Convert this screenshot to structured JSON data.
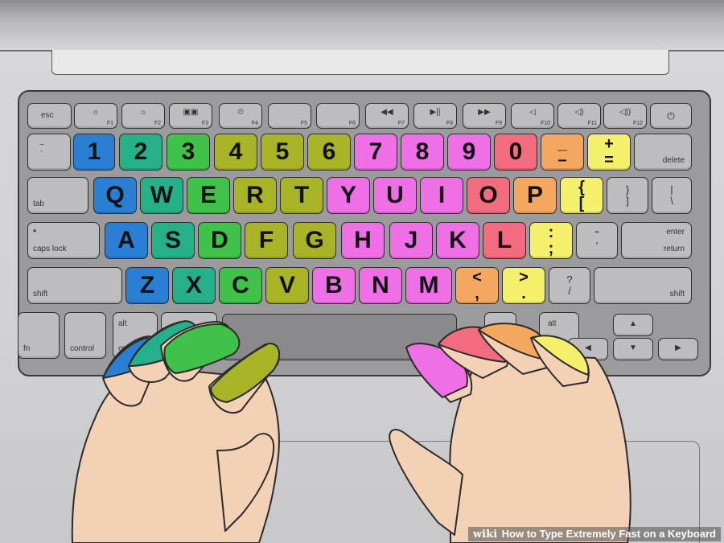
{
  "caption": {
    "brand": "wiki",
    "title": "How to Type Extremely Fast on a Keyboard"
  },
  "finger_colors": {
    "left_pinky": "#2a7fd4",
    "left_ring": "#26b08a",
    "left_middle": "#3fc14a",
    "left_index": "#a8b326",
    "right_index": "#ef6fe6",
    "right_middle": "#f26b7e",
    "right_ring": "#f4a85f",
    "right_pinky": "#f4f06c"
  },
  "keyboard": {
    "function_row": [
      {
        "id": "esc",
        "label": "esc"
      },
      {
        "id": "f1",
        "label": "F1",
        "icon": "☼"
      },
      {
        "id": "f2",
        "label": "F2",
        "icon": "☼"
      },
      {
        "id": "f3",
        "label": "F3",
        "icon": "▣▣"
      },
      {
        "id": "f4",
        "label": "F4",
        "icon": "⏲"
      },
      {
        "id": "f5",
        "label": "F5",
        "icon": ""
      },
      {
        "id": "f6",
        "label": "F6",
        "icon": ""
      },
      {
        "id": "f7",
        "label": "F7",
        "icon": "◀◀"
      },
      {
        "id": "f8",
        "label": "F8",
        "icon": "▶||"
      },
      {
        "id": "f9",
        "label": "F9",
        "icon": "▶▶"
      },
      {
        "id": "f10",
        "label": "F10",
        "icon": "◁"
      },
      {
        "id": "f11",
        "label": "F11",
        "icon": "◁)"
      },
      {
        "id": "f12",
        "label": "F12",
        "icon": "◁))"
      },
      {
        "id": "power",
        "label": "",
        "icon": "⏻"
      }
    ],
    "number_row": [
      {
        "label": "~",
        "sub": "`",
        "kind": "mod"
      },
      {
        "label": "1",
        "finger": "left_pinky"
      },
      {
        "label": "2",
        "finger": "left_ring"
      },
      {
        "label": "3",
        "finger": "left_middle"
      },
      {
        "label": "4",
        "finger": "left_index"
      },
      {
        "label": "5",
        "finger": "left_index"
      },
      {
        "label": "6",
        "finger": "left_index"
      },
      {
        "label": "7",
        "finger": "right_index"
      },
      {
        "label": "8",
        "finger": "right_index"
      },
      {
        "label": "9",
        "finger": "right_index"
      },
      {
        "label": "0",
        "finger": "right_middle"
      },
      {
        "label": "_",
        "sub": "–",
        "finger": "right_ring"
      },
      {
        "label": "+",
        "sub": "=",
        "finger": "right_pinky"
      },
      {
        "label": "delete",
        "kind": "mod"
      }
    ],
    "top_row": [
      {
        "label": "tab",
        "kind": "mod"
      },
      {
        "label": "Q",
        "finger": "left_pinky"
      },
      {
        "label": "W",
        "finger": "left_ring"
      },
      {
        "label": "E",
        "finger": "left_middle"
      },
      {
        "label": "R",
        "finger": "left_index"
      },
      {
        "label": "T",
        "finger": "left_index"
      },
      {
        "label": "Y",
        "finger": "right_index"
      },
      {
        "label": "U",
        "finger": "right_index"
      },
      {
        "label": "I",
        "finger": "right_index"
      },
      {
        "label": "O",
        "finger": "right_middle"
      },
      {
        "label": "P",
        "finger": "right_ring"
      },
      {
        "label": "{",
        "sub": "[",
        "finger": "right_pinky"
      },
      {
        "label": "}",
        "sub": "]",
        "kind": "mod"
      },
      {
        "label": "|",
        "sub": "\\",
        "kind": "mod"
      }
    ],
    "home_row": [
      {
        "label": "caps lock",
        "kind": "mod"
      },
      {
        "label": "A",
        "finger": "left_pinky"
      },
      {
        "label": "S",
        "finger": "left_ring"
      },
      {
        "label": "D",
        "finger": "left_middle"
      },
      {
        "label": "F",
        "finger": "left_index"
      },
      {
        "label": "G",
        "finger": "left_index"
      },
      {
        "label": "H",
        "finger": "right_index"
      },
      {
        "label": "J",
        "finger": "right_index"
      },
      {
        "label": "K",
        "finger": "right_index"
      },
      {
        "label": "L",
        "finger": "right_middle"
      },
      {
        "label": ":",
        "sub": ";",
        "finger": "right_pinky"
      },
      {
        "label": "\"",
        "sub": "'",
        "kind": "mod"
      },
      {
        "label": "enter",
        "sub": "return",
        "kind": "mod"
      }
    ],
    "bottom_row": [
      {
        "label": "shift",
        "kind": "mod"
      },
      {
        "label": "Z",
        "finger": "left_pinky"
      },
      {
        "label": "X",
        "finger": "left_ring"
      },
      {
        "label": "C",
        "finger": "left_middle"
      },
      {
        "label": "V",
        "finger": "left_index"
      },
      {
        "label": "B",
        "finger": "right_index"
      },
      {
        "label": "N",
        "finger": "right_index"
      },
      {
        "label": "M",
        "finger": "right_index"
      },
      {
        "label": "<",
        "sub": ",",
        "finger": "right_ring"
      },
      {
        "label": ">",
        "sub": ".",
        "finger": "right_pinky"
      },
      {
        "label": "?",
        "sub": "/",
        "kind": "mod"
      },
      {
        "label": "shift",
        "kind": "mod"
      }
    ],
    "modifier_row": [
      {
        "label": "fn"
      },
      {
        "label": "control"
      },
      {
        "label": "alt",
        "sub": "option"
      },
      {
        "label": ""
      },
      {
        "label": ""
      },
      {
        "label": "alt"
      }
    ],
    "arrows": {
      "up": "▲",
      "left": "◀",
      "down": "▼",
      "right": "▶"
    }
  }
}
